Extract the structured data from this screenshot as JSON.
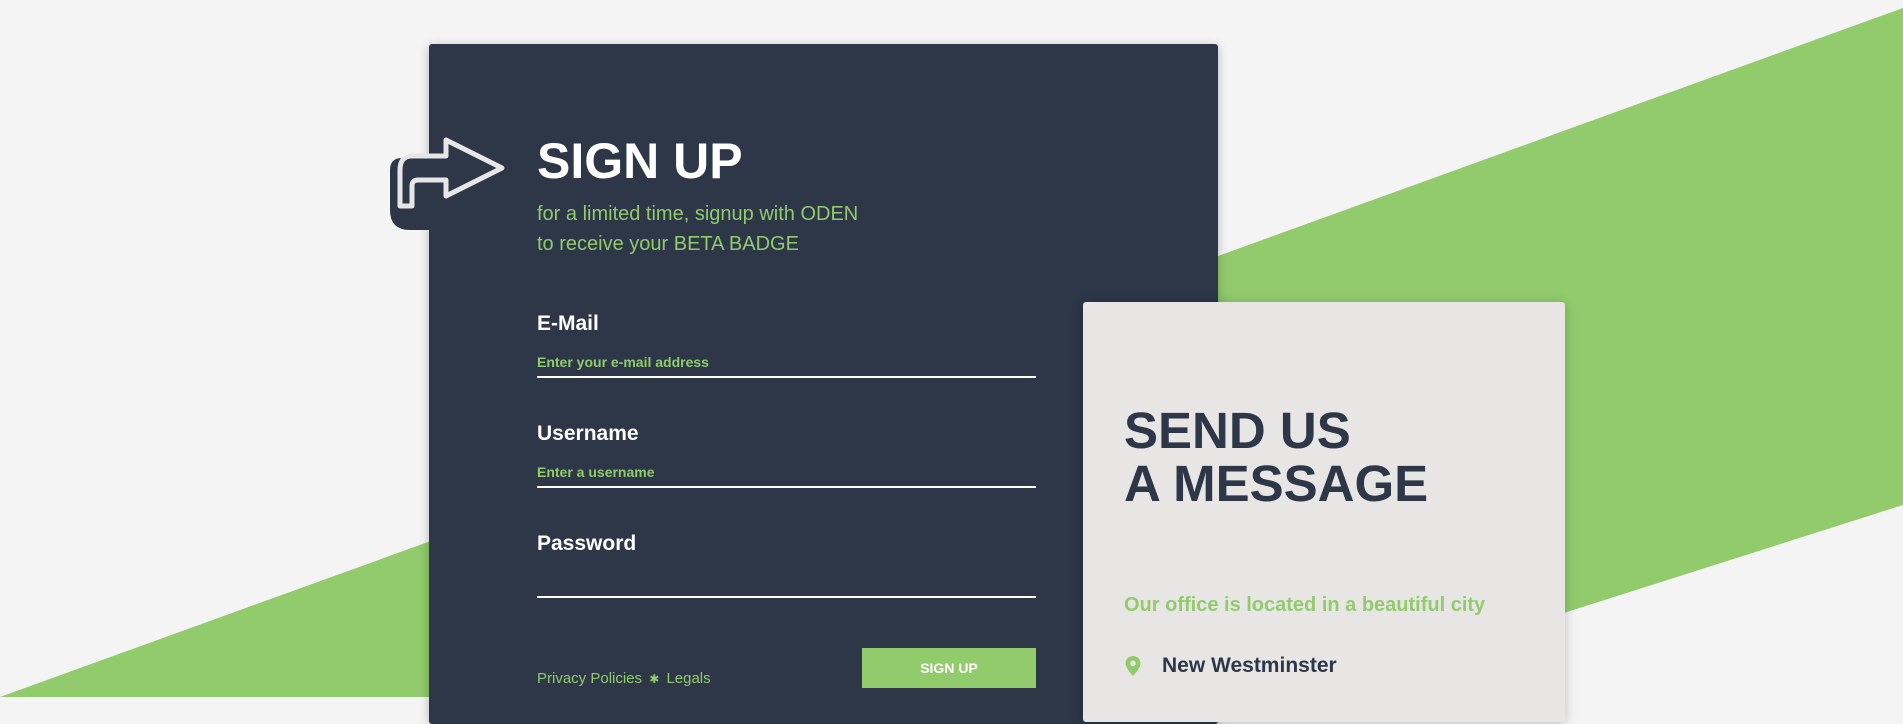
{
  "colors": {
    "page_background": "#f4f4f4",
    "accent_green": "#91cb6c",
    "dark_navy": "#2d3748",
    "message_card": "#e8e6e4",
    "white": "#ffffff"
  },
  "signup": {
    "icon": "arrow-right-icon",
    "title": "SIGN UP",
    "subtitle_line1": "for a limited time, signup with ODEN",
    "subtitle_line2": "to receive your BETA BADGE",
    "fields": {
      "email": {
        "label": "E-Mail",
        "placeholder": "Enter your e-mail address",
        "value": ""
      },
      "username": {
        "label": "Username",
        "placeholder": "Enter a username",
        "value": ""
      },
      "password": {
        "label": "Password",
        "placeholder": "",
        "value": ""
      }
    },
    "footer": {
      "privacy_label": "Privacy Policies",
      "separator_icon": "asterisk-icon",
      "separator": "✱",
      "legals_label": "Legals"
    },
    "submit_label": "SIGN UP"
  },
  "message": {
    "title_line1": "SEND US",
    "title_line2": "A MESSAGE",
    "office_text": "Our office is located in a beautiful city",
    "location_icon": "map-pin-icon",
    "location": "New Westminster"
  }
}
